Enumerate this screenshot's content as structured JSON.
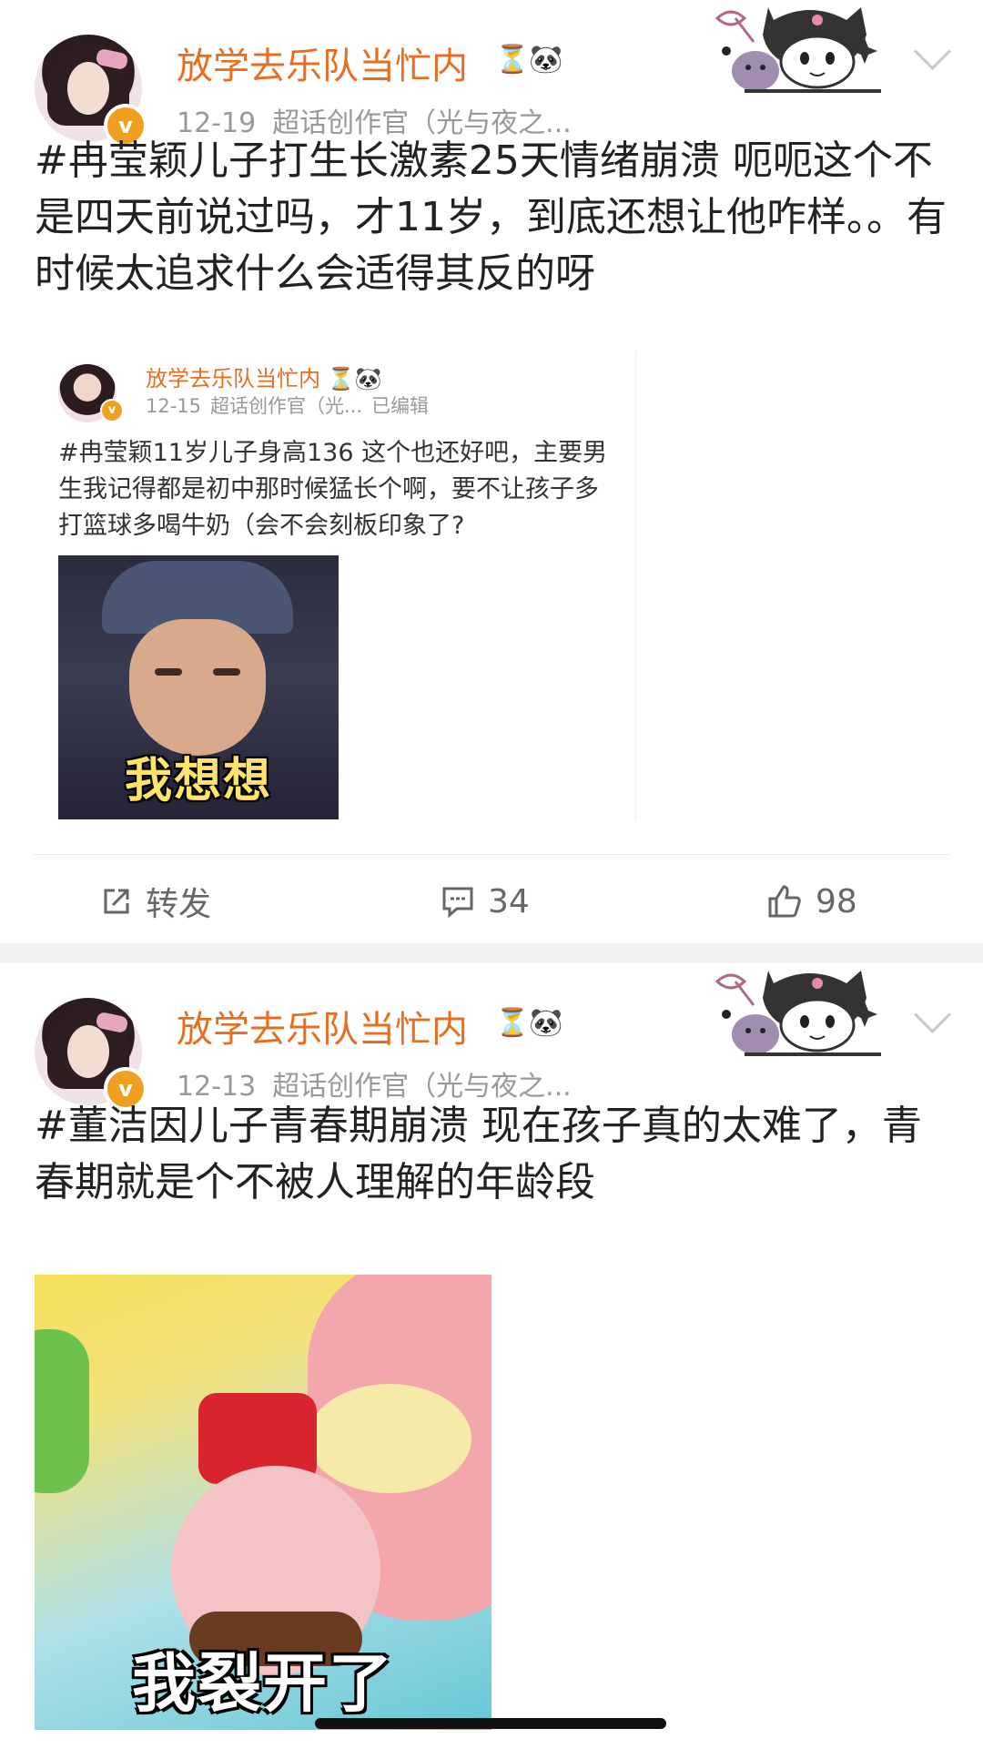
{
  "posts": [
    {
      "username": "放学去乐队当忙内",
      "badges": "⏳🐼",
      "date": "12-19",
      "source": "超话创作官（光与夜之...",
      "avatar_badge": "v",
      "content": "#冉莹颖儿子打生长激素25天情绪崩溃 呃呃这个不是四天前说过吗，才11岁，到底还想让他咋样。。有时候太追求什么会适得其反的呀",
      "quote": {
        "username": "放学去乐队当忙内",
        "badges": "⏳🐼",
        "date": "12-15",
        "source": "超话创作官（光...",
        "edited": "已编辑",
        "avatar_badge": "v",
        "content": "#冉莹颖11岁儿子身高136 这个也还好吧，主要男生我记得都是初中那时候猛长个啊，要不让孩子多打篮球多喝牛奶（会不会刻板印象了?",
        "image_caption": "我想想"
      },
      "actions": {
        "repost_label": "转发",
        "comment_count": "34",
        "like_count": "98"
      }
    },
    {
      "username": "放学去乐队当忙内",
      "badges": "⏳🐼",
      "date": "12-13",
      "source": "超话创作官（光与夜之...",
      "avatar_badge": "v",
      "content": "#董洁因儿子青春期崩溃 现在孩子真的太难了，青春期就是个不被人理解的年龄段",
      "image_caption": "我裂开了"
    }
  ],
  "icons": {
    "repost": "share-icon",
    "comment": "comment-icon",
    "like": "thumbs-up-icon",
    "more": "chevron-down-icon"
  },
  "colors": {
    "username": "#e96d1f",
    "meta": "#999999",
    "separator": "#f2f2f2",
    "verified": "#f0a020"
  }
}
